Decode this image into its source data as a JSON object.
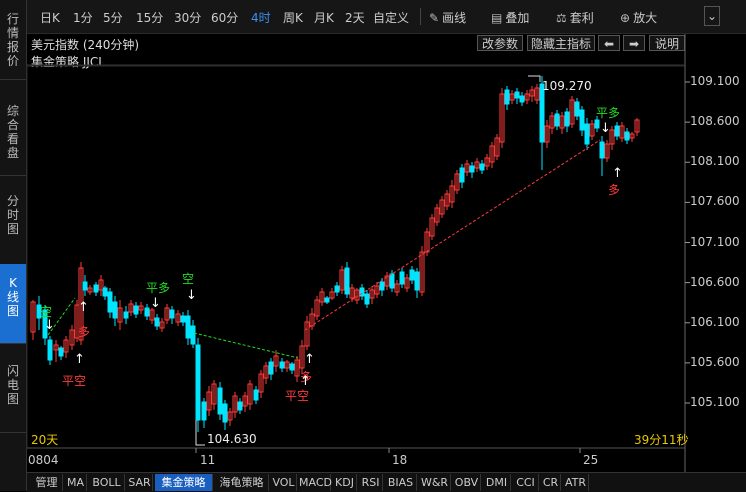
{
  "sidebar": {
    "items": [
      {
        "label": [
          "行",
          "情",
          "报",
          "价"
        ],
        "active": false
      },
      {
        "label": [
          "综",
          "合",
          "看",
          "盘"
        ],
        "active": false
      },
      {
        "label": [
          "分",
          "时",
          "图"
        ],
        "active": false
      },
      {
        "label": [
          "K",
          "线",
          "图"
        ],
        "active": true
      },
      {
        "label": [
          "闪",
          "电",
          "图"
        ],
        "active": false
      }
    ]
  },
  "toolbar": {
    "periods": [
      "日K",
      "1分",
      "5分",
      "15分",
      "30分",
      "60分",
      "4时",
      "周K",
      "月K",
      "2天",
      "自定义"
    ],
    "active_period": "4时",
    "draw": "画线",
    "overlay": "叠加",
    "arbitrage": "套利",
    "zoom": "放大"
  },
  "header": {
    "title": "美元指数 (240分钟)",
    "indicator": "集金策略 JJCL",
    "buttons": {
      "params": "改参数",
      "hide": "隐藏主指标",
      "prev": "⬅",
      "next": "➡",
      "help": "说明"
    }
  },
  "price_axis": [
    "109.100",
    "108.600",
    "108.100",
    "107.600",
    "107.100",
    "106.600",
    "106.100",
    "105.600",
    "105.100"
  ],
  "chart_labels": {
    "high": "109.270",
    "low": "104.630",
    "period_count": "20天",
    "countdown": "39分11秒"
  },
  "x_axis": [
    "0804",
    "11",
    "18",
    "25"
  ],
  "signals": [
    {
      "text": "空",
      "kind": "short"
    },
    {
      "text": "多",
      "kind": "long"
    },
    {
      "text": "平空",
      "kind": "close-short"
    },
    {
      "text": "平多",
      "kind": "close-long"
    },
    {
      "text": "空",
      "kind": "short"
    },
    {
      "text": "多",
      "kind": "long"
    },
    {
      "text": "平空",
      "kind": "close-short"
    },
    {
      "text": "平多",
      "kind": "close-long"
    },
    {
      "text": "多",
      "kind": "long"
    }
  ],
  "tabs": [
    "管理",
    "MA",
    "BOLL",
    "SAR",
    "集金策略",
    "海龟策略",
    "VOL",
    "MACD",
    "KDJ",
    "RSI",
    "BIAS",
    "W&R",
    "OBV",
    "DMI",
    "CCI",
    "CR",
    "ATR"
  ],
  "active_tab": "集金策略",
  "colors": {
    "up": "#ff3b3b",
    "down": "#00e5ff",
    "accent": "#1a6fd1",
    "signal_long": "#ff3b3b",
    "signal_short": "#22dd22"
  },
  "chart_data": {
    "type": "candlestick",
    "title": "美元指数 (240分钟)",
    "y_ticks": [
      109.1,
      108.6,
      108.1,
      107.6,
      107.1,
      106.6,
      106.1,
      105.6,
      105.1
    ],
    "ylim": [
      104.55,
      109.45
    ],
    "x_tick_labels": [
      "0804",
      "11",
      "18",
      "25"
    ],
    "annotations": [
      {
        "text": "109.270",
        "value": 109.27
      },
      {
        "text": "104.630",
        "value": 104.63
      }
    ]
  }
}
